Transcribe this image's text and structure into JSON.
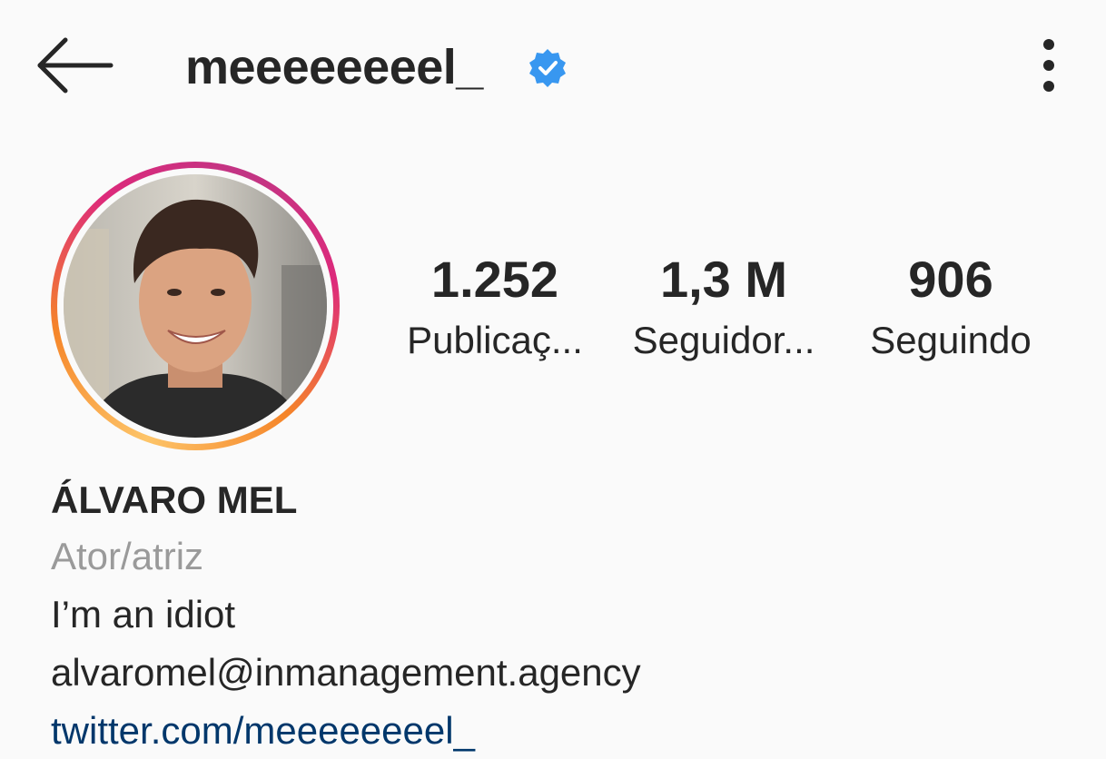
{
  "header": {
    "username": "meeeeeeeel_",
    "verified": true,
    "back_icon": "arrow-left-icon",
    "more_icon": "more-vertical-icon"
  },
  "stats": {
    "posts": {
      "value": "1.252",
      "label": "Publicaç..."
    },
    "followers": {
      "value": "1,3 M",
      "label": "Seguidor..."
    },
    "following": {
      "value": "906",
      "label": "Seguindo"
    }
  },
  "bio": {
    "full_name": "ÁLVARO MEL",
    "category": "Ator/atriz",
    "lines": [
      "I’m an idiot",
      "alvaromel@inmanagement.agency"
    ],
    "link": "twitter.com/meeeeeeeel_"
  },
  "colors": {
    "verified_badge": "#3897f0",
    "link": "#00376b",
    "category_text": "#9a9a9a"
  }
}
